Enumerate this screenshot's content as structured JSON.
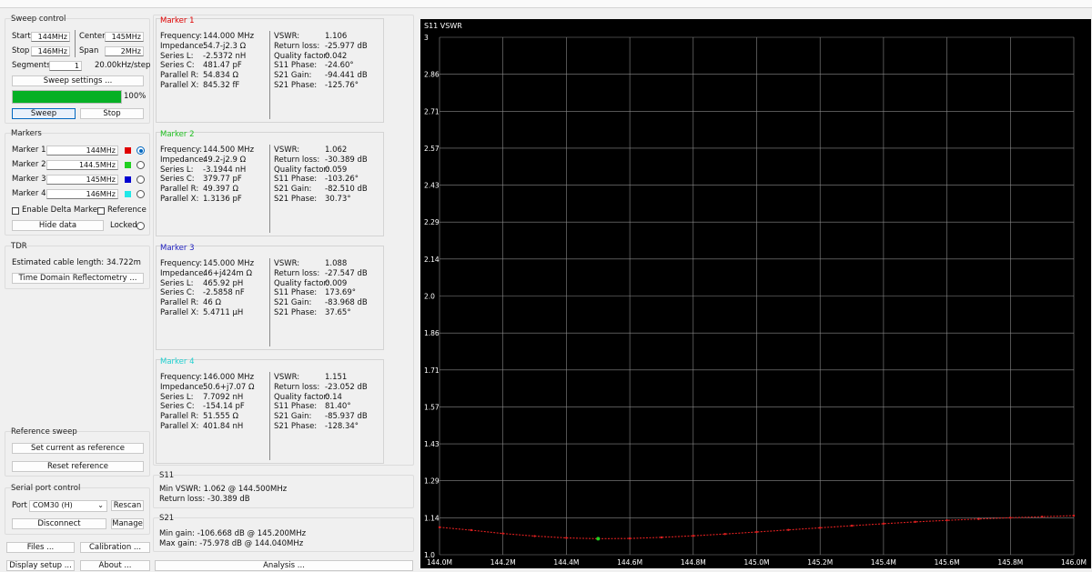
{
  "sweep_control": {
    "title": "Sweep control",
    "start_label": "Start",
    "start_value": "144MHz",
    "center_label": "Center",
    "center_value": "145MHz",
    "stop_label": "Stop",
    "stop_value": "146MHz",
    "span_label": "Span",
    "span_value": "2MHz",
    "segments_label": "Segments",
    "segments_value": "1",
    "step_text": "20.00kHz/step",
    "settings_button": "Sweep settings ...",
    "progress_percent": 100,
    "progress_text": "100%",
    "sweep_button": "Sweep",
    "stop_button": "Stop"
  },
  "markers_panel": {
    "title": "Markers",
    "items": [
      {
        "label": "Marker 1",
        "value": "144MHz",
        "color": "#e00000",
        "selected": true
      },
      {
        "label": "Marker 2",
        "value": "144.5MHz",
        "color": "#20d020",
        "selected": false
      },
      {
        "label": "Marker 3",
        "value": "145MHz",
        "color": "#0000d0",
        "selected": false
      },
      {
        "label": "Marker 4",
        "value": "146MHz",
        "color": "#20e8e8",
        "selected": false
      }
    ],
    "delta_label": "Enable Delta Marker",
    "reference_label": "Reference",
    "hide_data_button": "Hide data",
    "locked_label": "Locked"
  },
  "tdr": {
    "title": "TDR",
    "cable_length": "Estimated cable length: 34.722m",
    "tdr_button": "Time Domain Reflectometry ..."
  },
  "reference_sweep": {
    "title": "Reference sweep",
    "set_button": "Set current as reference",
    "reset_button": "Reset reference"
  },
  "serial_port": {
    "title": "Serial port control",
    "port_label": "Port",
    "port_value": "COM30 (H)",
    "rescan_button": "Rescan",
    "disconnect_button": "Disconnect",
    "manage_button": "Manage"
  },
  "bottom_buttons": {
    "files": "Files ...",
    "calibration": "Calibration ...",
    "display_setup": "Display setup ...",
    "about": "About ...",
    "analysis": "Analysis ..."
  },
  "marker_details": [
    {
      "title": "Marker 1",
      "title_color": "#e00000",
      "left": [
        [
          "Frequency:",
          "144.000 MHz"
        ],
        [
          "Impedance:",
          "54.7-j2.3 Ω"
        ],
        [
          "Series L:",
          "-2.5372 nH"
        ],
        [
          "Series C:",
          "481.47 pF"
        ],
        [
          "Parallel R:",
          "54.834 Ω"
        ],
        [
          "Parallel X:",
          "845.32 fF"
        ]
      ],
      "right": [
        [
          "VSWR:",
          "1.106"
        ],
        [
          "Return loss:",
          "-25.977 dB"
        ],
        [
          "Quality factor:",
          "0.042"
        ],
        [
          "S11 Phase:",
          "-24.60°"
        ],
        [
          "S21 Gain:",
          "-94.441 dB"
        ],
        [
          "S21 Phase:",
          "-125.76°"
        ]
      ]
    },
    {
      "title": "Marker 2",
      "title_color": "#20c020",
      "left": [
        [
          "Frequency:",
          "144.500 MHz"
        ],
        [
          "Impedance:",
          "49.2-j2.9 Ω"
        ],
        [
          "Series L:",
          "-3.1944 nH"
        ],
        [
          "Series C:",
          "379.77 pF"
        ],
        [
          "Parallel R:",
          "49.397 Ω"
        ],
        [
          "Parallel X:",
          "1.3136 pF"
        ]
      ],
      "right": [
        [
          "VSWR:",
          "1.062"
        ],
        [
          "Return loss:",
          "-30.389 dB"
        ],
        [
          "Quality factor:",
          "0.059"
        ],
        [
          "S11 Phase:",
          "-103.26°"
        ],
        [
          "S21 Gain:",
          "-82.510 dB"
        ],
        [
          "S21 Phase:",
          "30.73°"
        ]
      ]
    },
    {
      "title": "Marker 3",
      "title_color": "#2020c0",
      "left": [
        [
          "Frequency:",
          "145.000 MHz"
        ],
        [
          "Impedance:",
          "46+j424m Ω"
        ],
        [
          "Series L:",
          "465.92 pH"
        ],
        [
          "Series C:",
          "-2.5858 nF"
        ],
        [
          "Parallel R:",
          "46 Ω"
        ],
        [
          "Parallel X:",
          "5.4711 µH"
        ]
      ],
      "right": [
        [
          "VSWR:",
          "1.088"
        ],
        [
          "Return loss:",
          "-27.547 dB"
        ],
        [
          "Quality factor:",
          "0.009"
        ],
        [
          "S11 Phase:",
          "173.69°"
        ],
        [
          "S21 Gain:",
          "-83.968 dB"
        ],
        [
          "S21 Phase:",
          "37.65°"
        ]
      ]
    },
    {
      "title": "Marker 4",
      "title_color": "#20d0d0",
      "left": [
        [
          "Frequency:",
          "146.000 MHz"
        ],
        [
          "Impedance:",
          "50.6+j7.07 Ω"
        ],
        [
          "Series L:",
          "7.7092 nH"
        ],
        [
          "Series C:",
          "-154.14 pF"
        ],
        [
          "Parallel R:",
          "51.555 Ω"
        ],
        [
          "Parallel X:",
          "401.84 nH"
        ]
      ],
      "right": [
        [
          "VSWR:",
          "1.151"
        ],
        [
          "Return loss:",
          "-23.052 dB"
        ],
        [
          "Quality factor:",
          "0.14"
        ],
        [
          "S11 Phase:",
          "81.40°"
        ],
        [
          "S21 Gain:",
          "-85.937 dB"
        ],
        [
          "S21 Phase:",
          "-128.34°"
        ]
      ]
    }
  ],
  "s11_summary": {
    "title": "S11",
    "min_vswr": "Min VSWR: 1.062 @ 144.500MHz",
    "return_loss": "Return loss: -30.389 dB"
  },
  "s21_summary": {
    "title": "S21",
    "min_gain": "Min gain: -106.668 dB @ 145.200MHz",
    "max_gain": "Max gain: -75.978 dB @ 144.040MHz"
  },
  "chart_data": {
    "type": "line",
    "title": "S11 VSWR",
    "ylim": [
      1.0,
      3.0
    ],
    "y_ticks": [
      "3",
      "2.86",
      "2.71",
      "2.57",
      "2.43",
      "2.29",
      "2.14",
      "2.0",
      "1.86",
      "1.71",
      "1.57",
      "1.43",
      "1.29",
      "1.14",
      "1.0"
    ],
    "xlim": [
      144.0,
      146.0
    ],
    "x_ticks": [
      "144.0M",
      "144.2M",
      "144.4M",
      "144.6M",
      "144.8M",
      "145.0M",
      "145.2M",
      "145.4M",
      "145.6M",
      "145.8M",
      "146.0M"
    ],
    "grid": true,
    "series": [
      {
        "color": "#e02020",
        "x": [
          144.0,
          144.1,
          144.2,
          144.3,
          144.4,
          144.5,
          144.6,
          144.7,
          144.8,
          144.9,
          145.0,
          145.1,
          145.2,
          145.3,
          145.4,
          145.5,
          145.6,
          145.7,
          145.8,
          145.9,
          146.0
        ],
        "values": [
          1.106,
          1.095,
          1.082,
          1.072,
          1.065,
          1.062,
          1.063,
          1.067,
          1.073,
          1.08,
          1.088,
          1.096,
          1.104,
          1.112,
          1.12,
          1.127,
          1.133,
          1.138,
          1.143,
          1.147,
          1.151
        ]
      }
    ],
    "marker_point": {
      "x": 144.5,
      "y": 1.062,
      "color": "#20d020"
    }
  }
}
